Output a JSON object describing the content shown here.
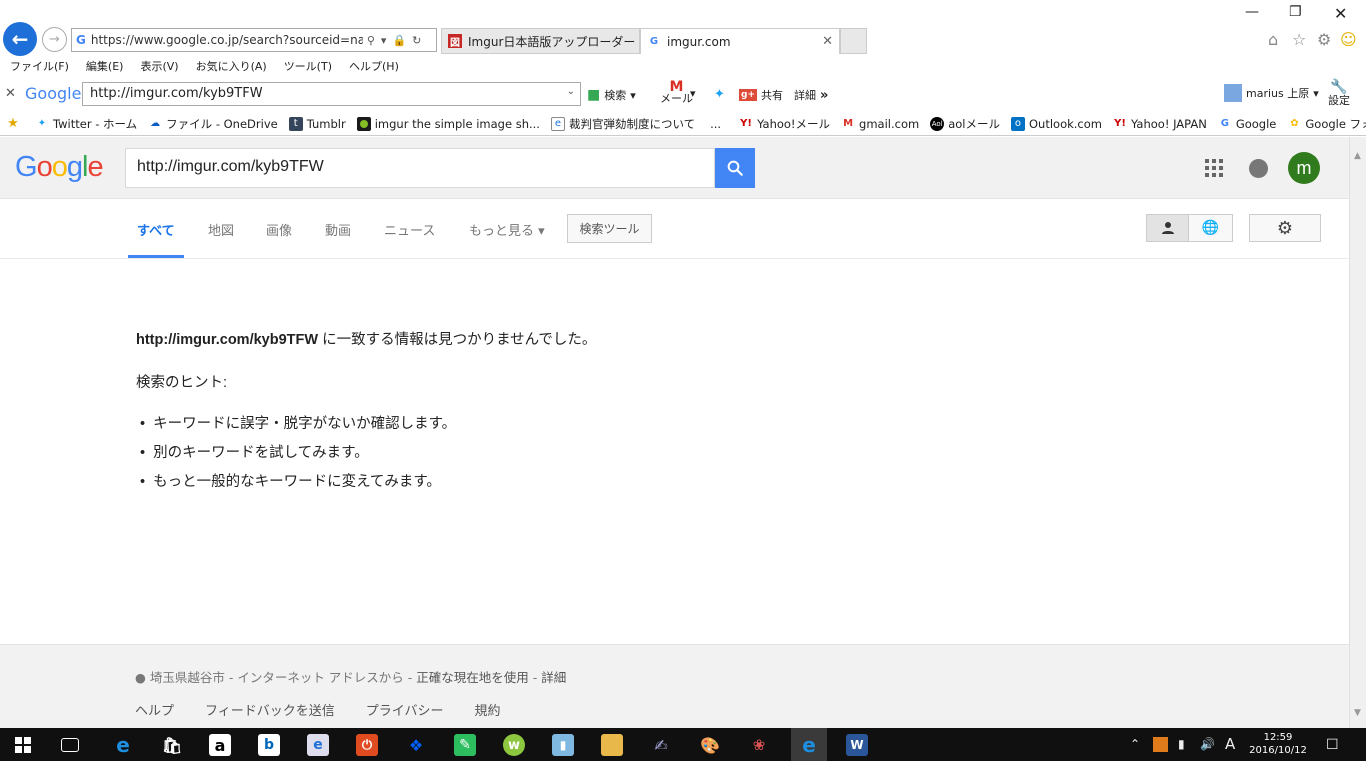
{
  "browser": {
    "address_url": "https://www.google.co.jp/search?sourceid=navclie",
    "tabs": [
      {
        "label": "Imgur日本語版アップローダー"
      },
      {
        "label": "imgur.com"
      }
    ],
    "menu": [
      "ファイル(F)",
      "編集(E)",
      "表示(V)",
      "お気に入り(A)",
      "ツール(T)",
      "ヘルプ(H)"
    ],
    "toolbar": {
      "logo": "Google",
      "query": "http://imgur.com/kyb9TFW",
      "search_label": "検索",
      "mail_label": "メール",
      "share_label": "共有",
      "details_label": "詳細",
      "more_label": "»",
      "user_label": "marius 上原",
      "settings_label": "設定"
    },
    "bookmarks": [
      "Twitter - ホーム",
      "ファイル - OneDrive",
      "Tumblr",
      "imgur the simple image sh...",
      "裁判官弾劾制度について",
      "...",
      "Yahoo!メール",
      "gmail.com",
      "aolメール",
      "Outlook.com",
      "Yahoo! JAPAN",
      "Google",
      "Google フォト"
    ]
  },
  "google": {
    "logo": "Google",
    "search_value": "http://imgur.com/kyb9TFW",
    "avatar_letter": "m",
    "tabs": [
      "すべて",
      "地図",
      "画像",
      "動画",
      "ニュース",
      "もっと見る ▾"
    ],
    "search_tools_label": "検索ツール",
    "result": {
      "query_bold": "http://imgur.com/kyb9TFW",
      "no_match_text": " に一致する情報は見つかりませんでした。",
      "hints_title": "検索のヒント:",
      "hints": [
        "キーワードに誤字・脱字がないか確認します。",
        "別のキーワードを試してみます。",
        "もっと一般的なキーワードに変えてみます。"
      ]
    },
    "footer": {
      "location_prefix": "● 埼玉県越谷市 - インターネット アドレスから - ",
      "use_precise": "正確な現在地を使用",
      "separator": " - ",
      "details": "詳細",
      "links": [
        "ヘルプ",
        "フィードバックを送信",
        "プライバシー",
        "規約"
      ]
    }
  },
  "taskbar": {
    "time": "12:59",
    "date": "2016/10/12",
    "ime": "A"
  }
}
